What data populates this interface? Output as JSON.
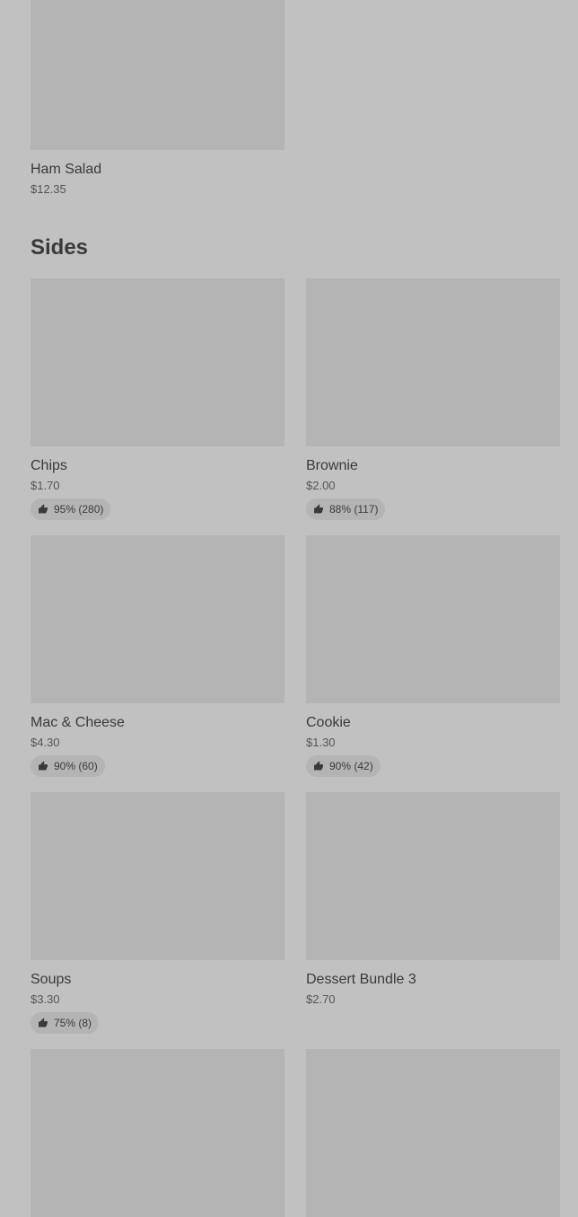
{
  "top_item": {
    "name": "Ham Salad",
    "price": "$12.35"
  },
  "section": {
    "title": "Sides"
  },
  "items": [
    {
      "name": "Chips",
      "price": "$1.70",
      "rating": "95% (280)"
    },
    {
      "name": "Brownie",
      "price": "$2.00",
      "rating": "88% (117)"
    },
    {
      "name": "Mac & Cheese",
      "price": "$4.30",
      "rating": "90% (60)"
    },
    {
      "name": "Cookie",
      "price": "$1.30",
      "rating": "90% (42)"
    },
    {
      "name": "Soups",
      "price": "$3.30",
      "rating": "75% (8)"
    },
    {
      "name": "Dessert Bundle 3",
      "price": "$2.70"
    }
  ],
  "icons": {
    "rating": "thumbs-up-icon"
  }
}
